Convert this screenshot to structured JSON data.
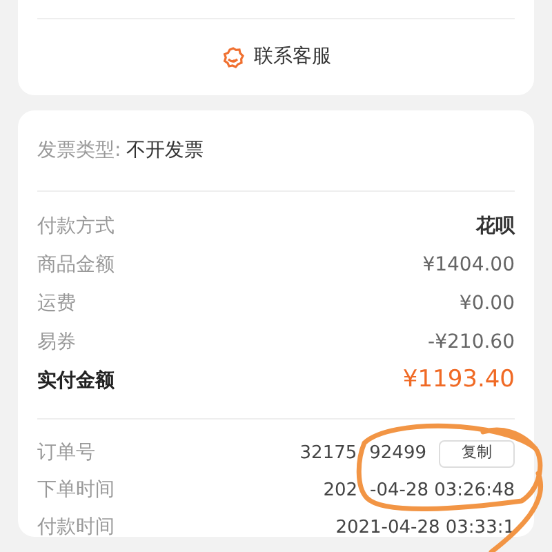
{
  "contact_button": {
    "label": "联系客服"
  },
  "invoice": {
    "label": "发票类型:",
    "value": "不开发票"
  },
  "payment_rows": [
    {
      "label": "付款方式",
      "value": "花呗",
      "kind": "method"
    },
    {
      "label": "商品金额",
      "value": "¥1404.00",
      "kind": "amount"
    },
    {
      "label": "运费",
      "value": "¥0.00",
      "kind": "amount"
    },
    {
      "label": "易券",
      "value": "-¥210.60",
      "kind": "amount"
    },
    {
      "label": "实付金额",
      "value": "¥1193.40",
      "kind": "total"
    }
  ],
  "order_rows": [
    {
      "label": "订单号",
      "value_parts": [
        "32175",
        "92499"
      ],
      "copy_button": "复制"
    },
    {
      "label": "下单时间",
      "value_parts": [
        "202",
        "-04-28 03:26:48"
      ]
    },
    {
      "label": "付款时间",
      "value_parts": [
        "2021-04-28 03:33:1"
      ]
    }
  ]
}
